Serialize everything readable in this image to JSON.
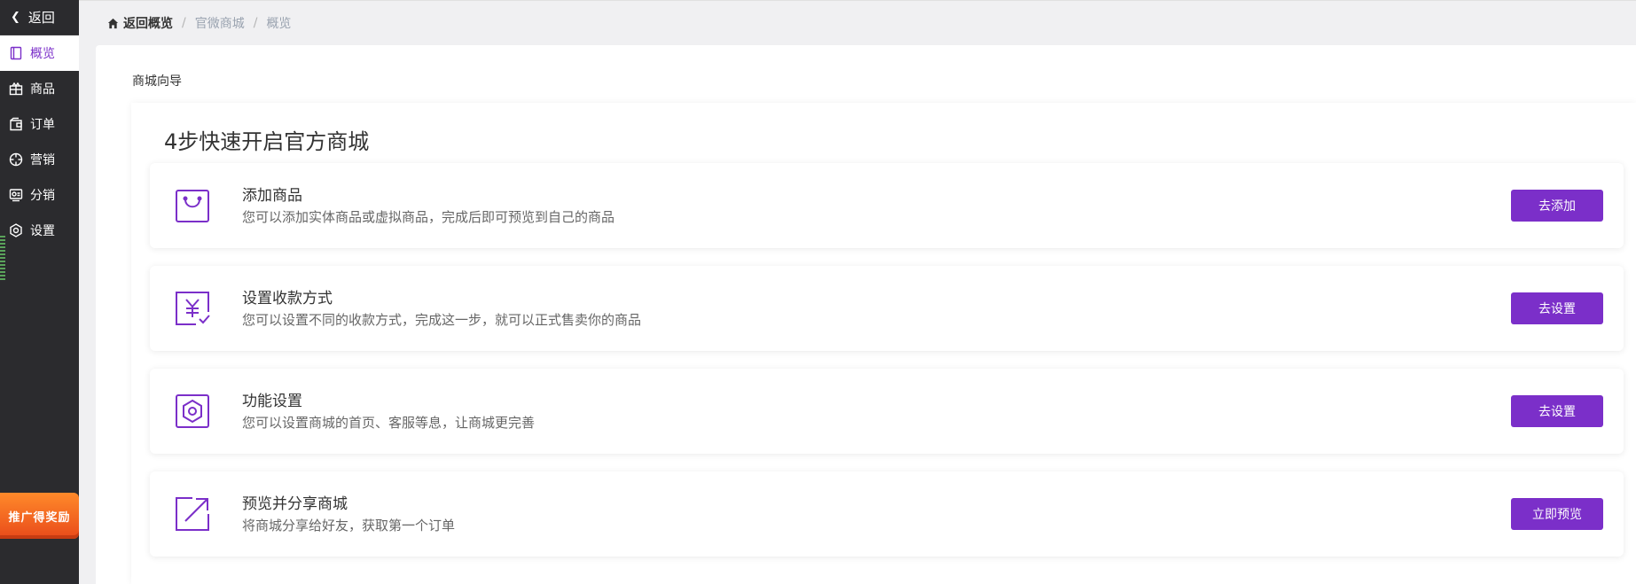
{
  "sidebar": {
    "back_label": "返回",
    "items": [
      {
        "label": "概览",
        "icon": "overview-icon",
        "active": true
      },
      {
        "label": "商品",
        "icon": "goods-icon"
      },
      {
        "label": "订单",
        "icon": "order-icon"
      },
      {
        "label": "营销",
        "icon": "marketing-icon"
      },
      {
        "label": "分销",
        "icon": "distribution-icon"
      },
      {
        "label": "设置",
        "icon": "settings-icon"
      }
    ],
    "promo_label": "推广得奖励"
  },
  "breadcrumb": {
    "home": "返回概览",
    "items": [
      "官微商城",
      "概览"
    ]
  },
  "main": {
    "guide_title": "商城向导",
    "card_title": "4步快速开启官方商城",
    "steps": [
      {
        "title": "添加商品",
        "desc": "您可以添加实体商品或虚拟商品，完成后即可预览到自己的商品",
        "button": "去添加",
        "icon": "shopping-bag-icon"
      },
      {
        "title": "设置收款方式",
        "desc": "您可以设置不同的收款方式，完成这一步，就可以正式售卖你的商品",
        "button": "去设置",
        "icon": "payment-icon"
      },
      {
        "title": "功能设置",
        "desc": "您可以设置商城的首页、客服等息，让商城更完善",
        "button": "去设置",
        "icon": "hexagon-settings-icon"
      },
      {
        "title": "预览并分享商城",
        "desc": "将商城分享给好友，获取第一个订单",
        "button": "立即预览",
        "icon": "share-icon"
      }
    ]
  },
  "colors": {
    "accent": "#7b2fc9",
    "sidebar_bg": "#2b2b2e",
    "page_bg": "#f0f0f2"
  }
}
